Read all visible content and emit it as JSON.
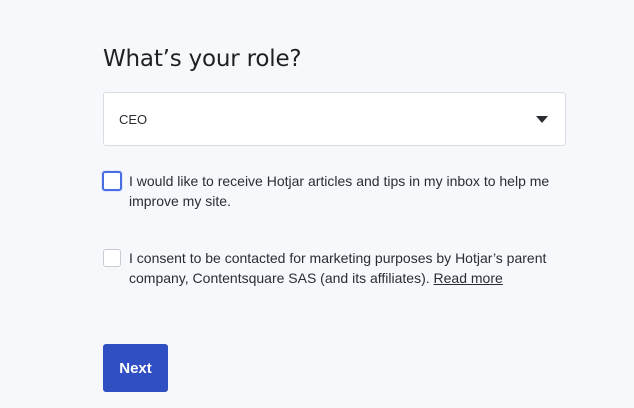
{
  "form": {
    "title": "What’s your role?",
    "role_select": {
      "value": "CEO",
      "icon": "caret-down-icon"
    },
    "checkboxes": [
      {
        "text": "I would like to receive Hotjar articles and tips in my inbox to help me improve my site.",
        "checked": false,
        "focused": true
      },
      {
        "text": "I consent to be contacted for marketing purposes by Hotjar’s parent company, Contentsquare SAS (and its affiliates).",
        "link_text": "Read more",
        "checked": false,
        "focused": false
      }
    ],
    "next_label": "Next"
  },
  "colors": {
    "background": "#f7f8fb",
    "accent": "#2f4fc3",
    "focus": "#4a6ee0"
  }
}
